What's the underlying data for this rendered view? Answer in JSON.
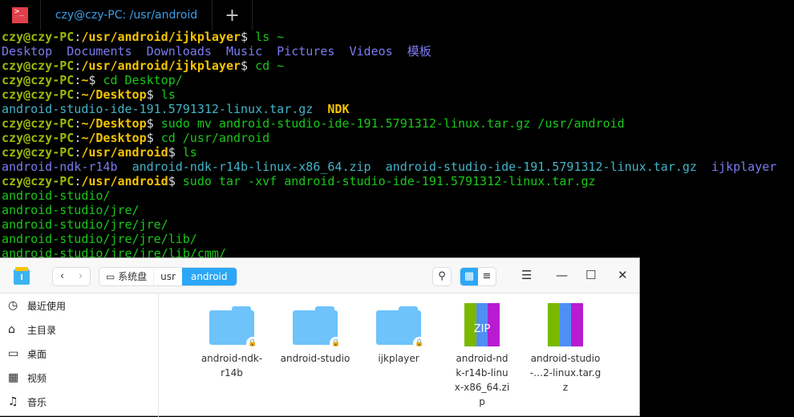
{
  "terminal": {
    "tab_title": "czy@czy-PC: /usr/android",
    "new_tab": "+",
    "lines": [
      [
        [
          "u",
          "czy@czy-PC"
        ],
        [
          "w",
          ":"
        ],
        [
          "p",
          "/usr/android/ijkplayer"
        ],
        [
          "w",
          "$ "
        ],
        [
          "c",
          "ls ~"
        ]
      ],
      [
        [
          "d",
          "Desktop  Documents  Downloads  Music  Pictures  Videos  模板"
        ]
      ],
      [
        [
          "u",
          "czy@czy-PC"
        ],
        [
          "w",
          ":"
        ],
        [
          "p",
          "/usr/android/ijkplayer"
        ],
        [
          "w",
          "$ "
        ],
        [
          "c",
          "cd ~"
        ]
      ],
      [
        [
          "u",
          "czy@czy-PC"
        ],
        [
          "w",
          ":"
        ],
        [
          "p",
          "~"
        ],
        [
          "w",
          "$ "
        ],
        [
          "c",
          "cd Desktop/"
        ]
      ],
      [
        [
          "u",
          "czy@czy-PC"
        ],
        [
          "w",
          ":"
        ],
        [
          "p",
          "~/Desktop"
        ],
        [
          "w",
          "$ "
        ],
        [
          "c",
          "ls"
        ]
      ],
      [
        [
          "f",
          "android-studio-ide-191.5791312-linux.tar.gz  "
        ],
        [
          "y",
          "NDK"
        ]
      ],
      [
        [
          "u",
          "czy@czy-PC"
        ],
        [
          "w",
          ":"
        ],
        [
          "p",
          "~/Desktop"
        ],
        [
          "w",
          "$ "
        ],
        [
          "c",
          "sudo mv android-studio-ide-191.5791312-linux.tar.gz /usr/android"
        ]
      ],
      [
        [
          "u",
          "czy@czy-PC"
        ],
        [
          "w",
          ":"
        ],
        [
          "p",
          "~/Desktop"
        ],
        [
          "w",
          "$ "
        ],
        [
          "c",
          "cd /usr/android"
        ]
      ],
      [
        [
          "u",
          "czy@czy-PC"
        ],
        [
          "w",
          ":"
        ],
        [
          "p",
          "/usr/android"
        ],
        [
          "w",
          "$ "
        ],
        [
          "c",
          "ls"
        ]
      ],
      [
        [
          "d",
          "android-ndk-r14b  "
        ],
        [
          "f",
          "android-ndk-r14b-linux-x86_64.zip  android-studio-ide-191.5791312-linux.tar.gz  "
        ],
        [
          "d",
          "ijkplayer"
        ]
      ],
      [
        [
          "u",
          "czy@czy-PC"
        ],
        [
          "w",
          ":"
        ],
        [
          "p",
          "/usr/android"
        ],
        [
          "w",
          "$ "
        ],
        [
          "c",
          "sudo tar -xvf android-studio-ide-191.5791312-linux.tar.gz"
        ]
      ],
      [
        [
          "c",
          "android-studio/"
        ]
      ],
      [
        [
          "c",
          "android-studio/jre/"
        ]
      ],
      [
        [
          "c",
          "android-studio/jre/jre/"
        ]
      ],
      [
        [
          "c",
          "android-studio/jre/jre/lib/"
        ]
      ],
      [
        [
          "c",
          "android-studio/jre/jre/lib/cmm/"
        ]
      ]
    ]
  },
  "file_manager": {
    "nav": {
      "back": "‹",
      "forward": "›"
    },
    "breadcrumb": [
      "系统盘",
      "usr",
      "android"
    ],
    "sidebar": [
      {
        "icon": "clock",
        "label": "最近使用"
      },
      {
        "icon": "home",
        "label": "主目录"
      },
      {
        "icon": "desktop",
        "label": "桌面"
      },
      {
        "icon": "video",
        "label": "视频"
      },
      {
        "icon": "music",
        "label": "音乐"
      }
    ],
    "items": [
      {
        "type": "folder",
        "name": "android-ndk-r14b"
      },
      {
        "type": "folder",
        "name": "android-studio"
      },
      {
        "type": "folder",
        "name": "ijkplayer"
      },
      {
        "type": "zip",
        "name": "android-ndk-r14b-linux-x86_64.zip",
        "badge": "ZIP"
      },
      {
        "type": "archive",
        "name": "android-studio-…2-linux.tar.gz"
      }
    ]
  }
}
